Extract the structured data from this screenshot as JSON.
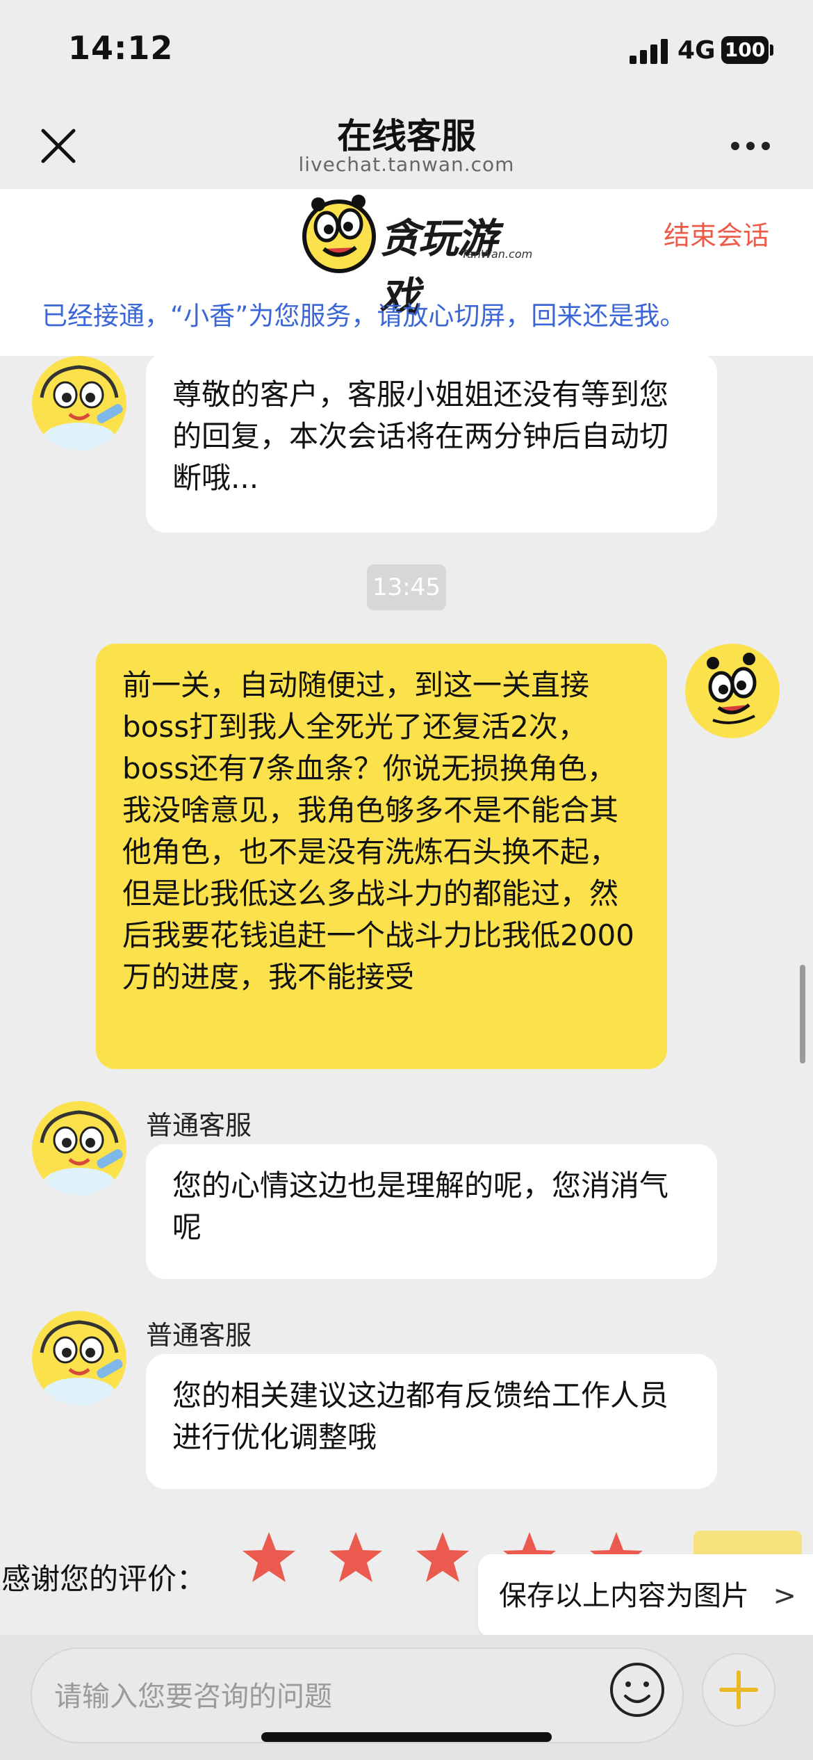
{
  "status_bar": {
    "time": "14:12",
    "network": "4G",
    "battery": "100"
  },
  "nav": {
    "title": "在线客服",
    "url": "livechat.tanwan.com"
  },
  "header": {
    "logo_text": "贪玩游戏",
    "logo_sub": "TanWan.com",
    "end_session": "结束会话",
    "notice": "已经接通，“小香”为您服务，请放心切屏，回来还是我。"
  },
  "messages": [
    {
      "from": "agent",
      "text": "尊敬的客户，客服小姐姐还没有等到您的回复，本次会话将在两分钟后自动切断哦..."
    },
    {
      "type": "timestamp",
      "text": "13:45"
    },
    {
      "from": "user",
      "text": "前一关，自动随便过，到这一关直接boss打到我人全死光了还复活2次，boss还有7条血条？你说无损换角色，我没啥意见，我角色够多不是不能合其他角色，也不是没有洗炼石头换不起，但是比我低这么多战斗力的都能过，然后我要花钱追赶一个战斗力比我低2000万的进度，我不能接受"
    },
    {
      "from": "agent",
      "sender": "普通客服",
      "text": "您的心情这边也是理解的呢，您消消气呢"
    },
    {
      "from": "agent",
      "sender": "普通客服",
      "text": "您的相关建议这边都有反馈给工作人员进行优化调整哦"
    }
  ],
  "rating": {
    "label": "感谢您的评价：",
    "stars": 5,
    "accent": "#ea5a4f"
  },
  "save_image": {
    "label": "保存以上内容为图片",
    "chevron": ">"
  },
  "input": {
    "placeholder": "请输入您要咨询的问题"
  },
  "colors": {
    "self_bubble": "#fbe14b",
    "agent_bubble": "#ffffff",
    "notice": "#3a66d6",
    "end_session": "#ef5b4a"
  }
}
